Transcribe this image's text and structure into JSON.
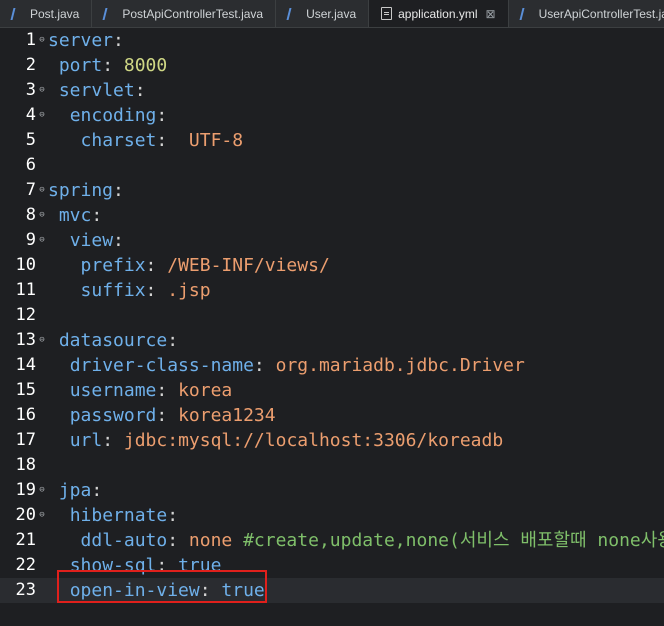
{
  "tabs": [
    {
      "label": "Post.java",
      "type": "java",
      "active": false
    },
    {
      "label": "PostApiControllerTest.java",
      "type": "java",
      "active": false
    },
    {
      "label": "User.java",
      "type": "java",
      "active": false
    },
    {
      "label": "application.yml",
      "type": "yaml",
      "active": true,
      "close_glyph": "⊠"
    },
    {
      "label": "UserApiControllerTest.java",
      "type": "java",
      "active": false
    }
  ],
  "lines": [
    {
      "n": "1",
      "fold": "⊖",
      "indent": "",
      "key": "server",
      "sep": ":",
      "value": "",
      "vtype": "",
      "comment": ""
    },
    {
      "n": "2",
      "fold": "",
      "indent": " ",
      "key": "port",
      "sep": ":",
      "value": " 8000",
      "vtype": "num",
      "comment": ""
    },
    {
      "n": "3",
      "fold": "⊖",
      "indent": " ",
      "key": "servlet",
      "sep": ":",
      "value": "",
      "vtype": "",
      "comment": ""
    },
    {
      "n": "4",
      "fold": "⊖",
      "indent": "  ",
      "key": "encoding",
      "sep": ":",
      "value": "",
      "vtype": "",
      "comment": ""
    },
    {
      "n": "5",
      "fold": "",
      "indent": "   ",
      "key": "charset",
      "sep": ":",
      "value": "  UTF-8",
      "vtype": "str",
      "comment": ""
    },
    {
      "n": "6",
      "fold": "",
      "indent": "",
      "key": "",
      "sep": "",
      "value": "",
      "vtype": "",
      "comment": ""
    },
    {
      "n": "7",
      "fold": "⊖",
      "indent": "",
      "key": "spring",
      "sep": ":",
      "value": "",
      "vtype": "",
      "comment": ""
    },
    {
      "n": "8",
      "fold": "⊖",
      "indent": " ",
      "key": "mvc",
      "sep": ":",
      "value": "",
      "vtype": "",
      "comment": ""
    },
    {
      "n": "9",
      "fold": "⊖",
      "indent": "  ",
      "key": "view",
      "sep": ":",
      "value": "",
      "vtype": "",
      "comment": ""
    },
    {
      "n": "10",
      "fold": "",
      "indent": "   ",
      "key": "prefix",
      "sep": ":",
      "value": " /WEB-INF/views/",
      "vtype": "str",
      "comment": ""
    },
    {
      "n": "11",
      "fold": "",
      "indent": "   ",
      "key": "suffix",
      "sep": ":",
      "value": " .jsp",
      "vtype": "str",
      "comment": ""
    },
    {
      "n": "12",
      "fold": "",
      "indent": "",
      "key": "",
      "sep": "",
      "value": "",
      "vtype": "",
      "comment": ""
    },
    {
      "n": "13",
      "fold": "⊖",
      "indent": " ",
      "key": "datasource",
      "sep": ":",
      "value": "",
      "vtype": "",
      "comment": ""
    },
    {
      "n": "14",
      "fold": "",
      "indent": "  ",
      "key": "driver-class-name",
      "sep": ":",
      "value": " org.mariadb.jdbc.Driver",
      "vtype": "str",
      "comment": ""
    },
    {
      "n": "15",
      "fold": "",
      "indent": "  ",
      "key": "username",
      "sep": ":",
      "value": " korea",
      "vtype": "str",
      "comment": ""
    },
    {
      "n": "16",
      "fold": "",
      "indent": "  ",
      "key": "password",
      "sep": ":",
      "value": " korea1234",
      "vtype": "str",
      "comment": ""
    },
    {
      "n": "17",
      "fold": "",
      "indent": "  ",
      "key": "url",
      "sep": ":",
      "value": " jdbc:mysql://localhost:3306/koreadb",
      "vtype": "str",
      "comment": ""
    },
    {
      "n": "18",
      "fold": "",
      "indent": "",
      "key": "",
      "sep": "",
      "value": "",
      "vtype": "",
      "comment": ""
    },
    {
      "n": "19",
      "fold": "⊖",
      "indent": " ",
      "key": "jpa",
      "sep": ":",
      "value": "",
      "vtype": "",
      "comment": ""
    },
    {
      "n": "20",
      "fold": "⊖",
      "indent": "  ",
      "key": "hibernate",
      "sep": ":",
      "value": "",
      "vtype": "",
      "comment": ""
    },
    {
      "n": "21",
      "fold": "",
      "indent": "   ",
      "key": "ddl-auto",
      "sep": ":",
      "value": " none",
      "vtype": "str",
      "comment": " #create,update,none(서비스 배포할때 none사용)"
    },
    {
      "n": "22",
      "fold": "",
      "indent": "  ",
      "key": "show-sql",
      "sep": ":",
      "value": " true",
      "vtype": "bool",
      "comment": ""
    },
    {
      "n": "23",
      "fold": "",
      "indent": "  ",
      "key": "open-in-view",
      "sep": ":",
      "value": " true",
      "vtype": "bool",
      "comment": "",
      "current": true
    }
  ],
  "colors": {
    "key": "#6fb0ea",
    "number": "#cfd785",
    "string": "#ec9e6f",
    "comment": "#7fbf6a",
    "highlight_box": "#e0201c"
  }
}
